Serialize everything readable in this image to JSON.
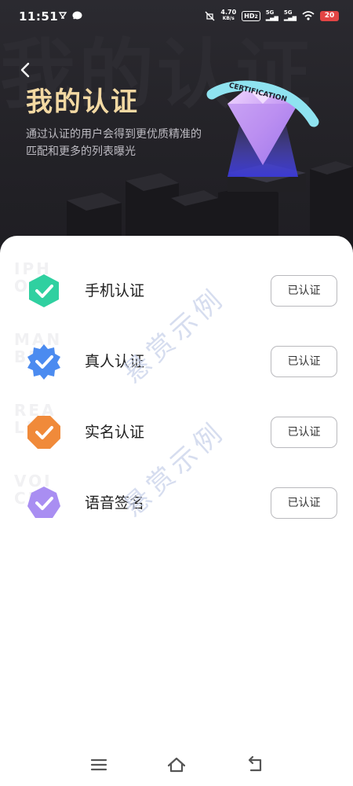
{
  "status_bar": {
    "time": "11:51",
    "net_speed": "4.70",
    "net_unit": "KB/s",
    "hd": "HD",
    "hd_sub": "2",
    "sig1": "5G",
    "sig2": "5G",
    "battery": "20",
    "icons": [
      "notification-icon",
      "message-icon",
      "mute-icon",
      "wifi-icon"
    ]
  },
  "header": {
    "bg_text": "我的认证",
    "title": "我的认证",
    "subtitle": "通过认证的用户会得到更优质精准的匹配和更多的列表曝光",
    "badge_text": "CERTIFICATION"
  },
  "items": [
    {
      "label": "手机认证",
      "button": "已认证",
      "bg_text": "IPH ONE",
      "color": "#2fd0a0",
      "icon": "check-hexagon-icon"
    },
    {
      "label": "真人认证",
      "button": "已认证",
      "bg_text": "MAN BE",
      "color": "#4b8bf0",
      "icon": "check-star-badge-icon"
    },
    {
      "label": "实名认证",
      "button": "已认证",
      "bg_text": "REA LLY",
      "color": "#f08a3a",
      "icon": "check-octagon-icon"
    },
    {
      "label": "语音签名",
      "button": "已认证",
      "bg_text": "VOI CE",
      "color": "#a98ef2",
      "icon": "check-heptagon-icon"
    }
  ],
  "watermark": "悬赏示例",
  "nav": {
    "icons": [
      "menu-icon",
      "home-icon",
      "back-icon"
    ]
  },
  "colors": {
    "header_bg": "#252429",
    "title": "#f3d9a3",
    "gem": "#c9a4f3"
  }
}
